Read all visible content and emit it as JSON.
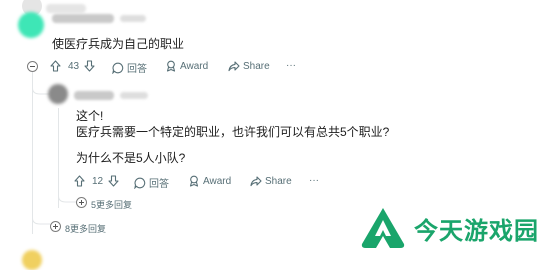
{
  "comment_1": {
    "text": "使医疗兵成为自己的职业",
    "upvotes": "43",
    "reply_label": "回答",
    "award_label": "Award",
    "share_label": "Share",
    "more_label": "···",
    "more_replies": "8更多回复"
  },
  "comment_2": {
    "line_1": "这个!",
    "line_2": "医疗兵需要一个特定的职业，也许我们可以有总共5个职业?",
    "line_3": "为什么不是5人小队?",
    "upvotes": "12",
    "reply_label": "回答",
    "award_label": "Award",
    "share_label": "Share",
    "more_label": "···",
    "more_replies": "5更多回复"
  },
  "watermark": {
    "text": "今天游戏园",
    "color": "#1aa56b"
  },
  "colors": {
    "avatar_1": "#3ee6b6",
    "action_text": "#576f76",
    "thread_line": "#e3e6e8"
  }
}
